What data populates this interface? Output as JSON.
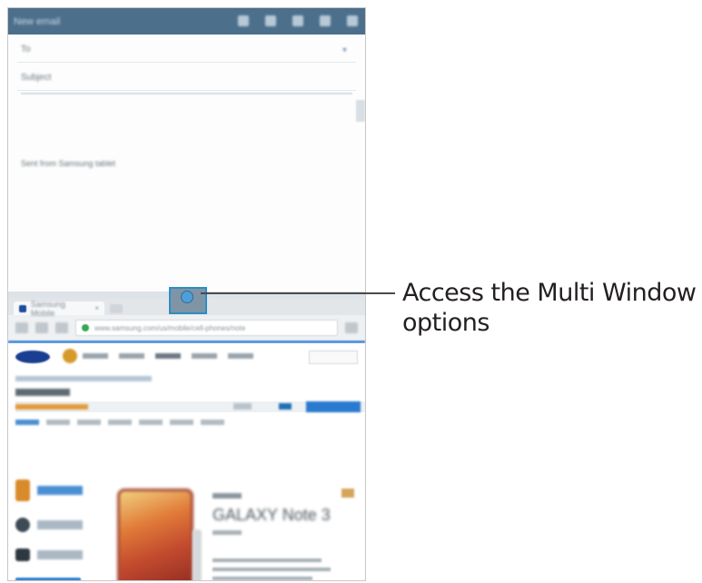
{
  "email_window": {
    "toolbar_title": "New email",
    "to_label": "To",
    "subject_label": "Subject",
    "signature": "Sent from Samsung tablet"
  },
  "browser_window": {
    "tab_title": "Samsung Mobile",
    "tab_close": "×",
    "url": "www.samsung.com/us/mobile/cell-phones/note",
    "product_title": "GALAXY Note 3"
  },
  "callout": {
    "text": "Access the Multi Window options"
  },
  "colors": {
    "email_toolbar": "#4c6f8c",
    "handle_border": "#2c8dc7",
    "handle_dot": "#4f9fd6",
    "callout_line": "#4a4a4a",
    "callout_text": "#231f20"
  },
  "icons": {
    "to_dropdown": "chevron-down-icon",
    "handle": "multi-window-handle-icon"
  }
}
